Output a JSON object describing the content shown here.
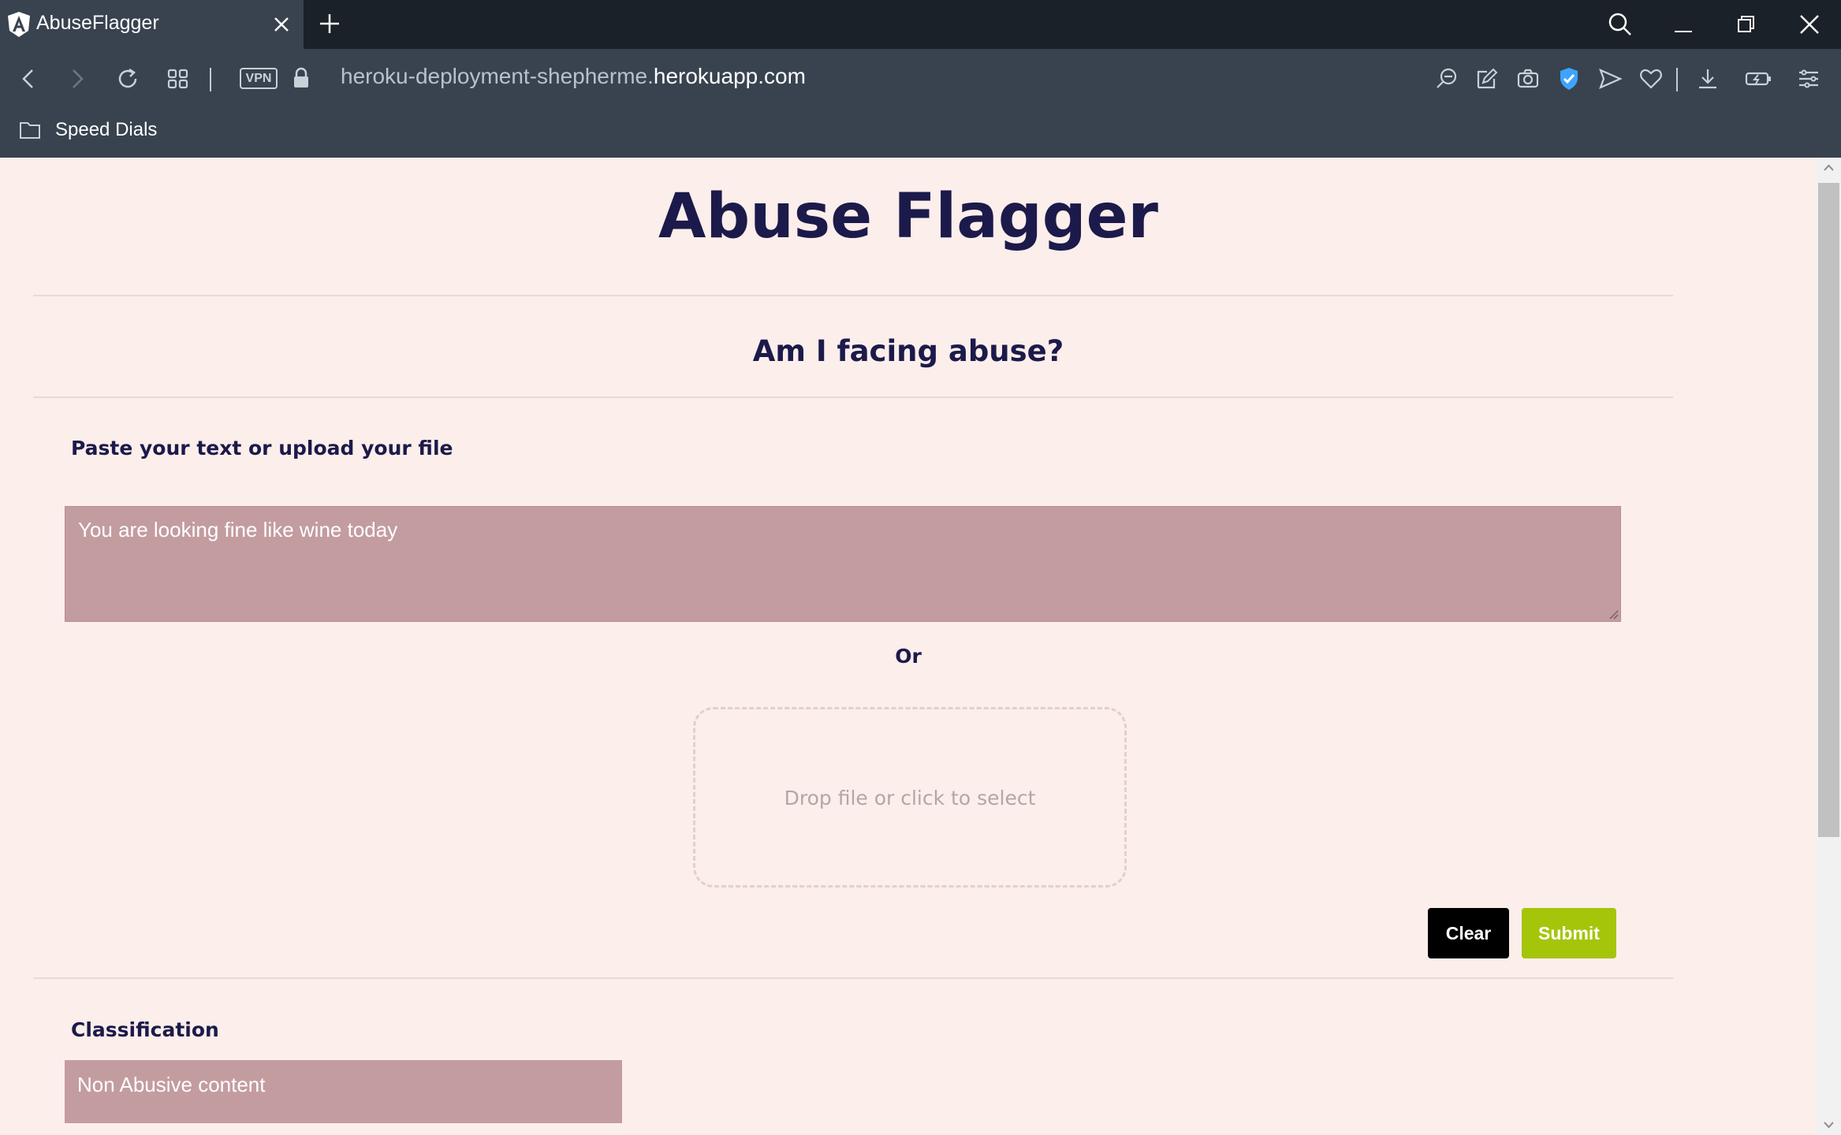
{
  "browser": {
    "tab": {
      "title": "AbuseFlagger",
      "favicon": "angular-logo-icon"
    },
    "url": {
      "prefix": "heroku-deployment-shepherme.",
      "domain": "herokuapp.com"
    },
    "vpn_label": "VPN",
    "bookmarks_bar": {
      "folder_label": "Speed Dials"
    }
  },
  "page": {
    "title": "Abuse Flagger",
    "subtitle": "Am I facing abuse?",
    "input_section": {
      "label": "Paste your text or upload your file",
      "text_value": "You are looking fine like wine today",
      "or_text": "Or",
      "dropzone_text": "Drop file or click to select"
    },
    "actions": {
      "clear_label": "Clear",
      "submit_label": "Submit"
    },
    "classification": {
      "label": "Classification",
      "value": "Non Abusive content"
    }
  },
  "colors": {
    "page_background": "#fbeeeb",
    "heading": "#1c1a4a",
    "field_background": "#c39ca0",
    "submit": "#a4c50a",
    "clear": "#000000"
  }
}
